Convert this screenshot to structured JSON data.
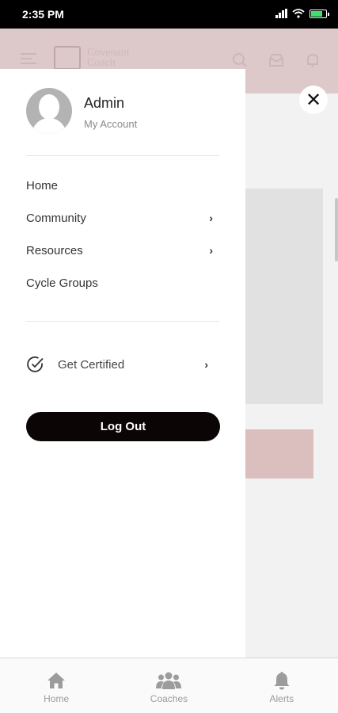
{
  "status_bar": {
    "time": "2:35 PM",
    "battery_level": 0.8
  },
  "header": {
    "logo_text_line1": "Covenant",
    "logo_text_line2": "Coach",
    "icons": [
      "menu-icon",
      "search-icon",
      "inbox-icon",
      "bell-icon"
    ]
  },
  "drawer": {
    "user": {
      "name": "Admin",
      "subtitle": "My Account"
    },
    "menu": [
      {
        "label": "Home",
        "has_submenu": false
      },
      {
        "label": "Community",
        "has_submenu": true
      },
      {
        "label": "Resources",
        "has_submenu": true
      },
      {
        "label": "Cycle Groups",
        "has_submenu": false
      }
    ],
    "certified": {
      "label": "Get Certified"
    },
    "logout_label": "Log Out"
  },
  "bottom_nav": {
    "items": [
      {
        "label": "Home",
        "icon": "home-icon"
      },
      {
        "label": "Coaches",
        "icon": "coaches-icon"
      },
      {
        "label": "Alerts",
        "icon": "bell-icon"
      }
    ]
  },
  "colors": {
    "header_bg": "#e9d4d4",
    "logout_bg": "#0c0505",
    "accent_pink": "#e7caca"
  }
}
